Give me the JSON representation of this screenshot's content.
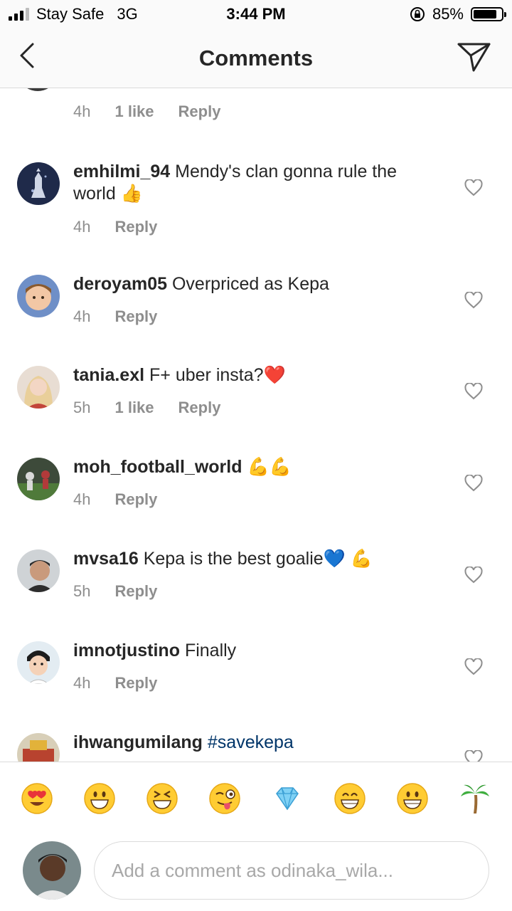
{
  "status_bar": {
    "carrier": "Stay Safe",
    "network": "3G",
    "time": "3:44 PM",
    "battery_percent": "85%",
    "battery_level": 0.85,
    "signal_bars_filled": 3,
    "signal_bars_total": 4
  },
  "nav": {
    "title": "Comments",
    "back_icon": "chevron-left-icon",
    "send_icon": "paper-plane-icon"
  },
  "partial_comment": {
    "time": "4h",
    "likes": "1 like",
    "reply": "Reply"
  },
  "comments": [
    {
      "username": "emhilmi_94",
      "text": "Mendy's clan gonna rule the world 👍",
      "time": "4h",
      "likes": "",
      "reply": "Reply"
    },
    {
      "username": "deroyam05",
      "text": "Overpriced as Kepa",
      "time": "4h",
      "likes": "",
      "reply": "Reply"
    },
    {
      "username": "tania.exl",
      "text": "F+ uber insta?❤️",
      "time": "5h",
      "likes": "1 like",
      "reply": "Reply"
    },
    {
      "username": "moh_football_world",
      "text": "💪💪",
      "time": "4h",
      "likes": "",
      "reply": "Reply"
    },
    {
      "username": "mvsa16",
      "text": "Kepa is the best goalie💙 💪",
      "time": "5h",
      "likes": "",
      "reply": "Reply"
    },
    {
      "username": "imnotjustino",
      "text": "Finally",
      "time": "4h",
      "likes": "",
      "reply": "Reply"
    },
    {
      "username": "ihwangumilang",
      "text": "#savekepa",
      "time": "",
      "likes": "",
      "reply": ""
    }
  ],
  "emoji_bar": [
    "heart-eyes-emoji",
    "grinning-emoji",
    "laughing-emoji",
    "winking-tongue-emoji",
    "gem-emoji",
    "beaming-emoji",
    "grinning-emoji",
    "palm-tree-emoji"
  ],
  "composer": {
    "placeholder": "Add a comment as odinaka_wila...",
    "value": ""
  },
  "colors": {
    "text": "#262626",
    "muted": "#8e8e8e",
    "hashtag": "#003569",
    "divider": "#dbdbdb"
  }
}
